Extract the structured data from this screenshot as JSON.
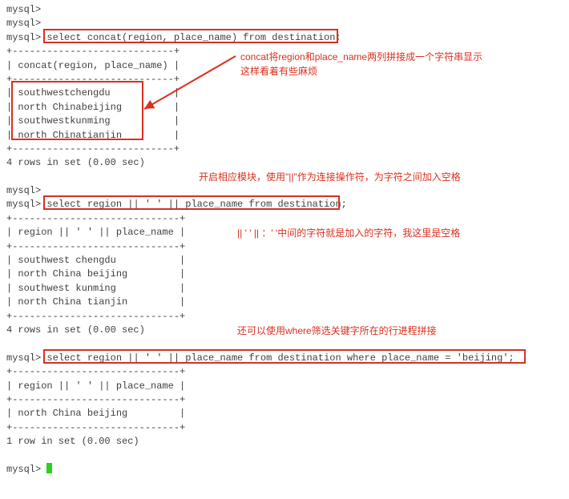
{
  "prompts": {
    "p0": "mysql>",
    "p1": "mysql>",
    "p2": "mysql> ",
    "p3": "mysql>",
    "p4": "mysql> ",
    "p5": "mysql> ",
    "p6": "mysql> "
  },
  "queries": {
    "q1": "select concat(region, place_name) from destination;",
    "q2": "select region || ' ' || place_name from destination;",
    "q3": "select region || ' ' || place_name from destination where place_name = 'beijing';"
  },
  "headers": {
    "h1": "| concat(region, place_name) |",
    "h2": "| region || ' ' || place_name |",
    "h3": "| region || ' ' || place_name |"
  },
  "separators": {
    "sep1": "+----------------------------+",
    "sep2": "+-----------------------------+"
  },
  "results": {
    "r1": [
      "| southwestchengdu           |",
      "| north Chinabeijing         |",
      "| southwestkunming           |",
      "| north Chinatianjin         |"
    ],
    "r2": [
      "| southwest chengdu           |",
      "| north China beijing         |",
      "| southwest kunming           |",
      "| north China tianjin         |"
    ],
    "r3": [
      "| north China beijing         |"
    ]
  },
  "footers": {
    "f1": "4 rows in set (0.00 sec)",
    "f2": "4 rows in set (0.00 sec)",
    "f3": "1 row in set (0.00 sec)"
  },
  "annotations": {
    "a1_line1": "concat将region和place_name两列拼接成一个字符串显示",
    "a1_line2": "这样看着有些麻烦",
    "a2": "开启相应模块，使用\"||\"作为连接操作符，为字符之间加入空格",
    "a3": "|| ' ' ||   ：' '中间的字符就是加入的字符，我这里是空格",
    "a4": "还可以使用where筛选关键字所在的行进程拼接"
  }
}
